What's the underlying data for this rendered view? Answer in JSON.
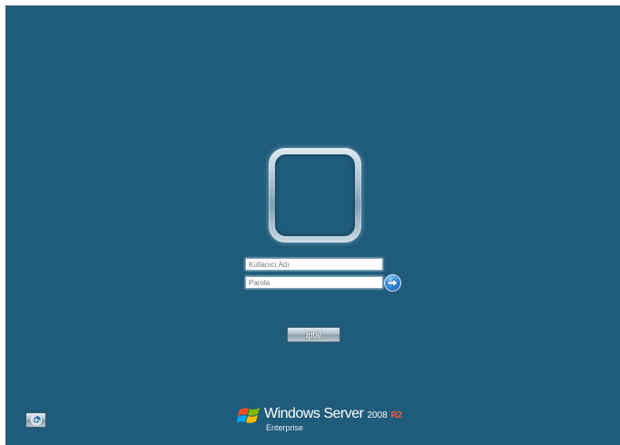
{
  "login": {
    "username_placeholder": "Kullanıcı Adı",
    "password_placeholder": "Parola",
    "cancel_label": "İptal"
  },
  "branding": {
    "product": "Windows Server",
    "version": "2008",
    "release": "R2",
    "edition": "Enterprise"
  },
  "icons": {
    "submit": "arrow-right-icon",
    "ease_of_access": "ease-of-access-icon",
    "logo": "windows-flag-logo"
  },
  "colors": {
    "background": "#1f5b7a",
    "release_accent": "#ff5a3a"
  }
}
